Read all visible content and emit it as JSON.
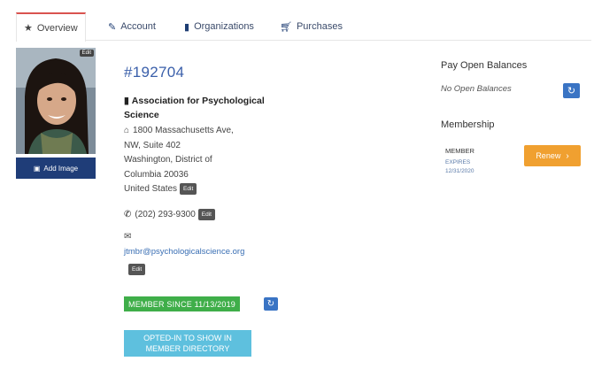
{
  "tabs": [
    {
      "label": "Overview",
      "icon": "star-icon",
      "active": true
    },
    {
      "label": "Account",
      "icon": "edit-icon",
      "active": false
    },
    {
      "label": "Organizations",
      "icon": "building-icon",
      "active": false
    },
    {
      "label": "Purchases",
      "icon": "cart-icon",
      "active": false
    }
  ],
  "profile": {
    "photo_edit_label": "Edit",
    "add_image_label": "Add Image"
  },
  "contact": {
    "member_id": "#192704",
    "org_name": "Association for Psychological Science",
    "address_line1": "1800 Massachusetts Ave,",
    "address_line2": "NW, Suite 402",
    "address_line3": "Washington, District of",
    "address_line4": "Columbia 20036",
    "address_line5": "United States",
    "phone": "(202) 293-9300",
    "email": "jtmbr@psychologicalscience.org",
    "edit_label": "Edit"
  },
  "badges": {
    "member_since": "MEMBER SINCE 11/13/2019",
    "opted_in_line1": "OPTED-IN TO SHOW IN",
    "opted_in_line2": "MEMBER DIRECTORY"
  },
  "balances": {
    "title": "Pay Open Balances",
    "value": "No Open Balances"
  },
  "membership": {
    "title": "Membership",
    "status": "MEMBER",
    "expires_label": "EXPIRES",
    "expires_date": "12/31/2020",
    "renew_label": "Renew"
  },
  "colors": {
    "accent_tab": "#d9534f",
    "navy": "#1f3d78",
    "member_badge": "#3fae49",
    "optin_badge": "#5ec0de",
    "renew": "#f0a030",
    "refresh": "#3a74c4"
  }
}
